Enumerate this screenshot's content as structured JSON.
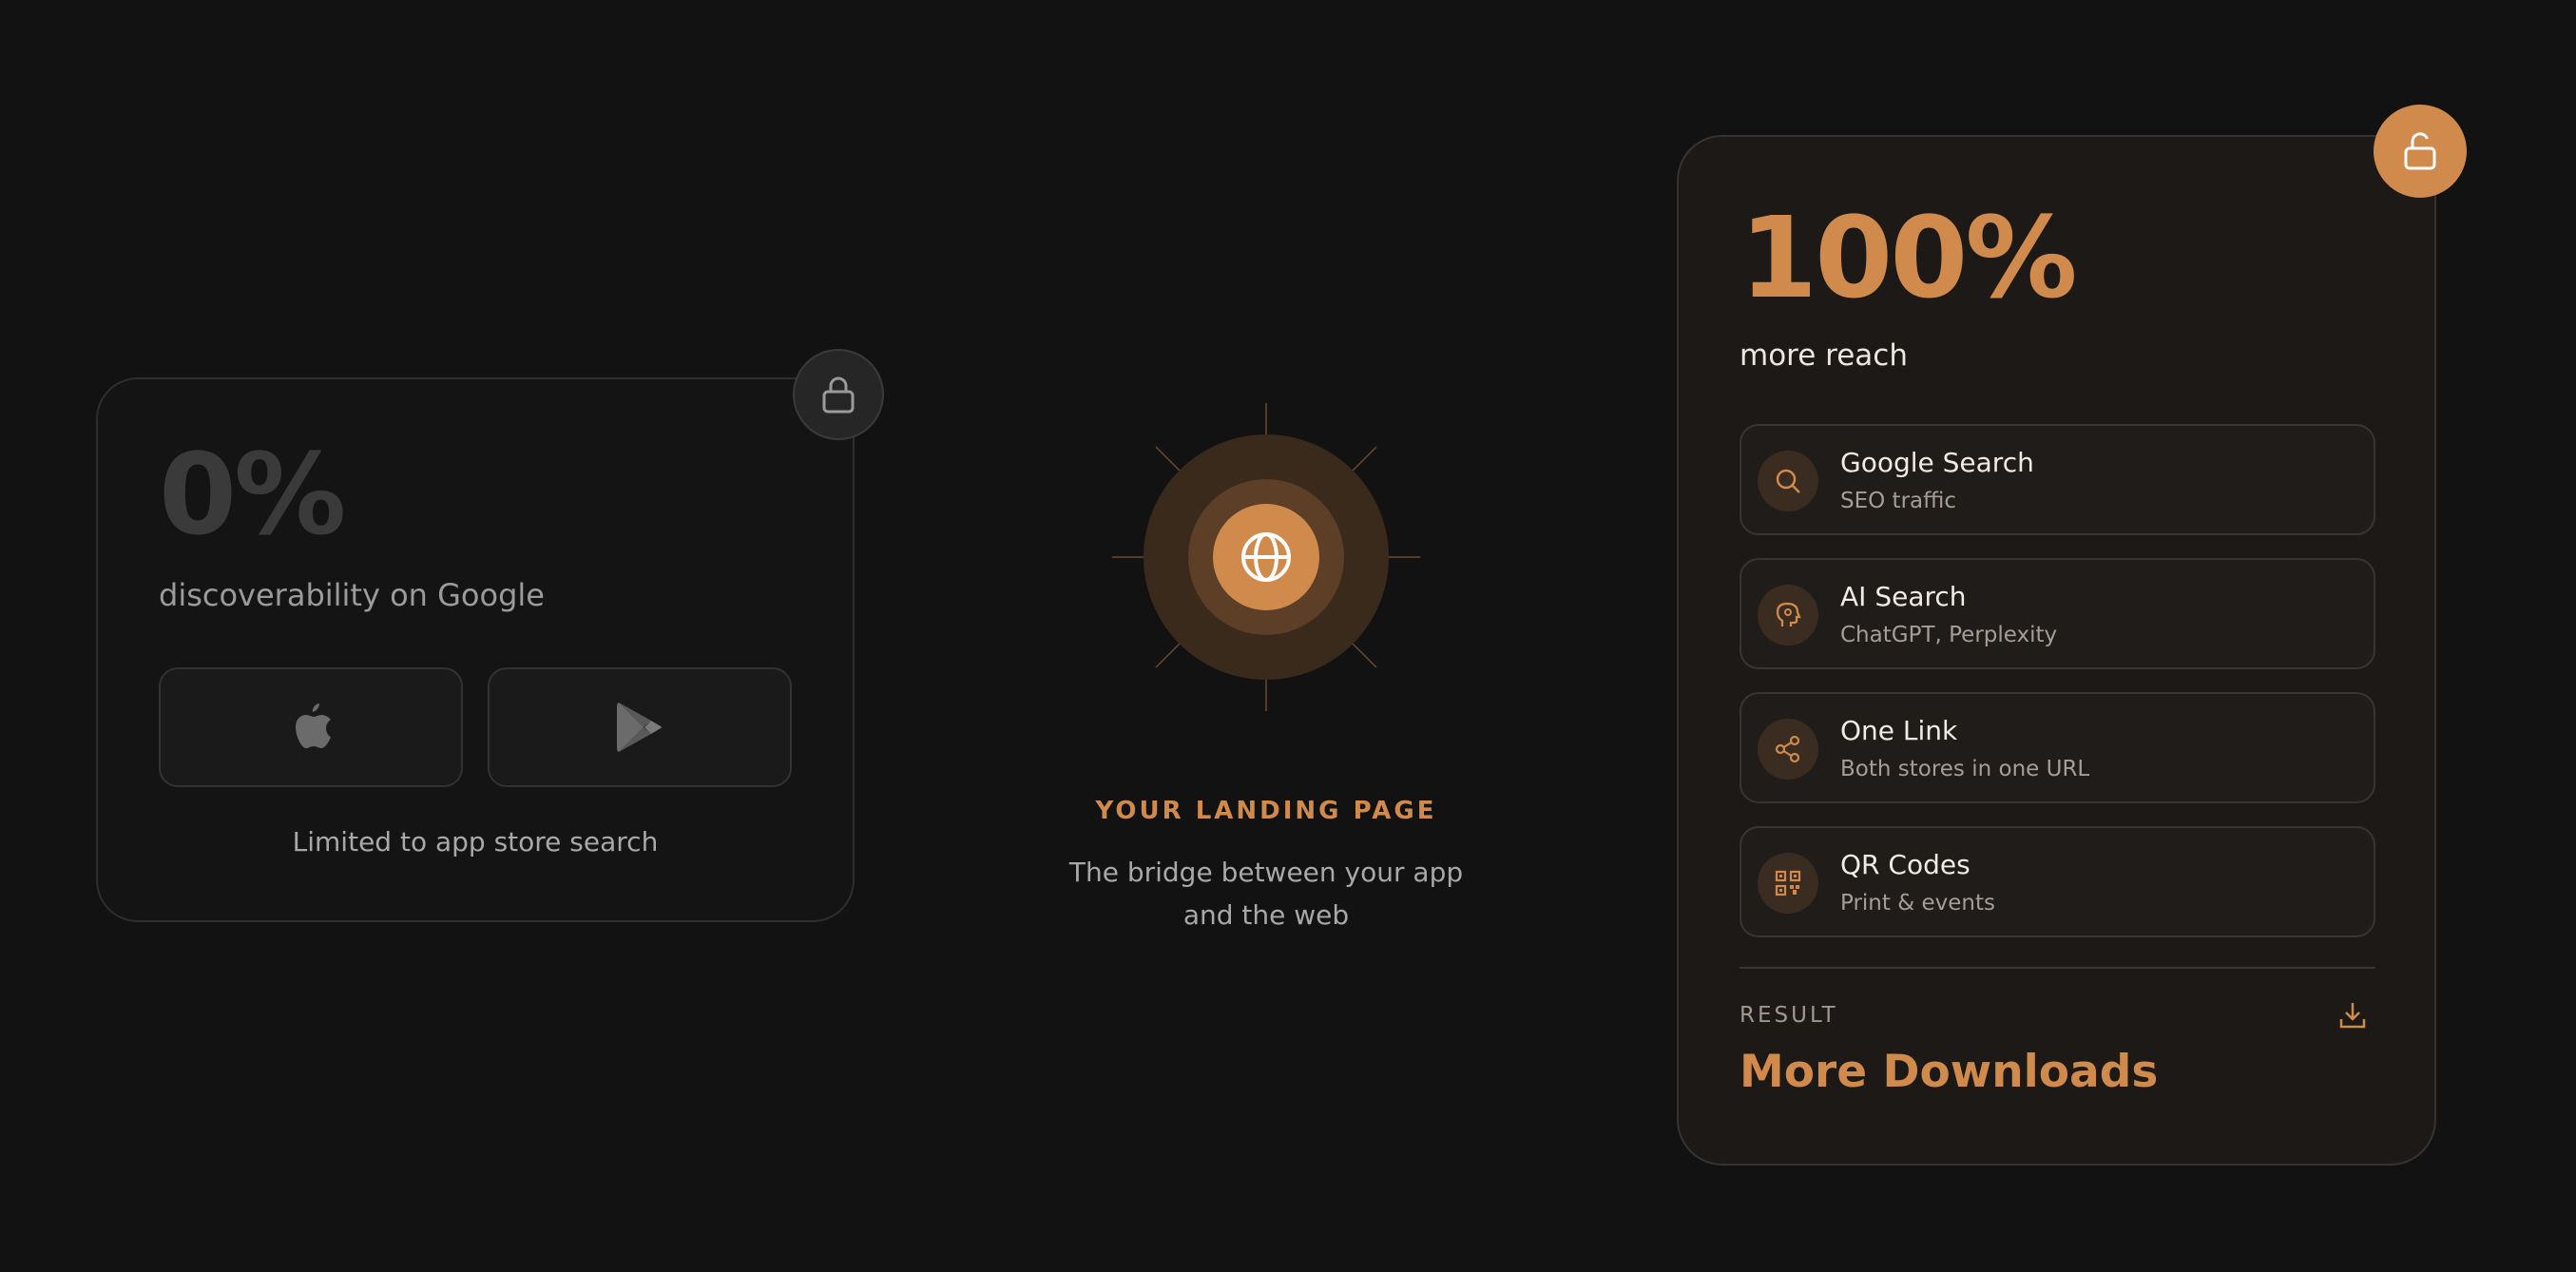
{
  "colors": {
    "accent": "#d08a4c",
    "background": "#121212",
    "muted": "#3a3a3a"
  },
  "left_card": {
    "stat": "0%",
    "subtitle": "discoverability on Google",
    "caption": "Limited to app store search",
    "badge_icon": "lock-icon",
    "buttons": [
      {
        "icon": "apple-icon"
      },
      {
        "icon": "google-play-icon"
      }
    ]
  },
  "middle": {
    "icon": "globe-icon",
    "title": "YOUR LANDING PAGE",
    "subtitle_line1": "The bridge between your app",
    "subtitle_line2": "and the web"
  },
  "right_card": {
    "stat": "100%",
    "subtitle": "more reach",
    "badge_icon": "unlock-icon",
    "features": [
      {
        "title": "Google Search",
        "desc": "SEO traffic",
        "icon": "search-icon"
      },
      {
        "title": "AI Search",
        "desc": "ChatGPT, Perplexity",
        "icon": "ai-head-icon"
      },
      {
        "title": "One Link",
        "desc": "Both stores in one URL",
        "icon": "share-icon"
      },
      {
        "title": "QR Codes",
        "desc": "Print & events",
        "icon": "qr-code-icon"
      }
    ],
    "result_label": "RESULT",
    "result_value": "More Downloads",
    "result_icon": "download-icon"
  }
}
